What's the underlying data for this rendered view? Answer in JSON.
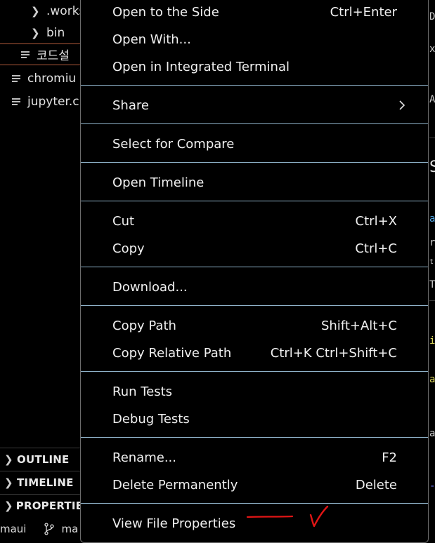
{
  "explorer": {
    "items": [
      {
        "label": ".works",
        "type": "folder"
      },
      {
        "label": "bin",
        "type": "folder"
      },
      {
        "label": "코드설",
        "type": "file"
      },
      {
        "label": "chromiu",
        "type": "file"
      },
      {
        "label": "jupyter.c",
        "type": "file"
      }
    ]
  },
  "panels": [
    "OUTLINE",
    "TIMELINE",
    "PROPERTIES"
  ],
  "statusbar": {
    "project": "maui",
    "branch": "ma"
  },
  "context_menu": {
    "groups": [
      [
        {
          "label": "Open to the Side",
          "shortcut": "Ctrl+Enter"
        },
        {
          "label": "Open With...",
          "shortcut": ""
        },
        {
          "label": "Open in Integrated Terminal",
          "shortcut": ""
        }
      ],
      [
        {
          "label": "Share",
          "shortcut": "",
          "submenu": true
        }
      ],
      [
        {
          "label": "Select for Compare",
          "shortcut": ""
        }
      ],
      [
        {
          "label": "Open Timeline",
          "shortcut": ""
        }
      ],
      [
        {
          "label": "Cut",
          "shortcut": "Ctrl+X"
        },
        {
          "label": "Copy",
          "shortcut": "Ctrl+C"
        }
      ],
      [
        {
          "label": "Download...",
          "shortcut": ""
        }
      ],
      [
        {
          "label": "Copy Path",
          "shortcut": "Shift+Alt+C"
        },
        {
          "label": "Copy Relative Path",
          "shortcut": "Ctrl+K Ctrl+Shift+C"
        }
      ],
      [
        {
          "label": "Run Tests",
          "shortcut": ""
        },
        {
          "label": "Debug Tests",
          "shortcut": ""
        }
      ],
      [
        {
          "label": "Rename...",
          "shortcut": "F2"
        },
        {
          "label": "Delete Permanently",
          "shortcut": "Delete"
        }
      ],
      [
        {
          "label": "View File Properties",
          "shortcut": ""
        }
      ]
    ]
  },
  "editor_edge": {
    "fragments": [
      {
        "text": "D",
        "color": "#cfcfcf"
      },
      {
        "text": "xt",
        "color": "#cfcfcf"
      },
      {
        "text": "AN",
        "color": "#cfcfcf"
      },
      {
        "text": "S",
        "color": "#e0e0e0"
      },
      {
        "text": "a",
        "color": "#4fa3e0"
      },
      {
        "text": "r",
        "color": "#cfcfcf"
      },
      {
        "text": "t",
        "color": "#cfcfcf"
      },
      {
        "text": "T",
        "color": "#cfcfcf"
      },
      {
        "text": "i",
        "color": "#d7d35a"
      },
      {
        "text": "a",
        "color": "#d7d35a"
      },
      {
        "text": "a",
        "color": "#cfcfcf"
      },
      {
        "text": "-",
        "color": "#6f7bff"
      }
    ]
  },
  "annotation": {
    "color": "#e01515"
  },
  "theme": {
    "separator": "#8fb2c9",
    "selection_border": "#b05a3a"
  }
}
